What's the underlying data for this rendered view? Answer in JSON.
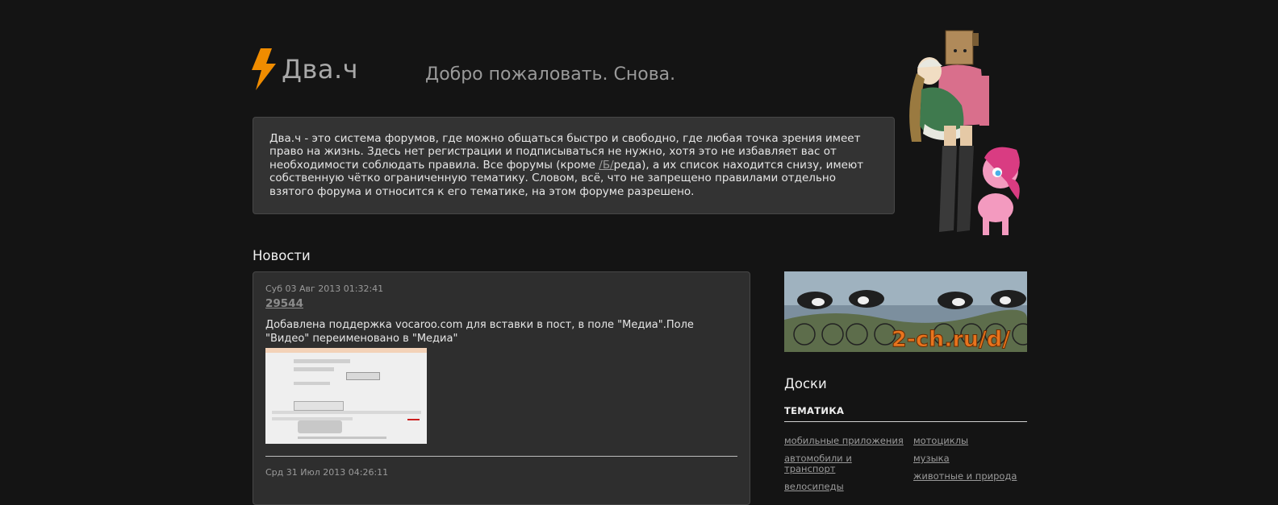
{
  "header": {
    "site_name": "Два.ч",
    "tagline": "Добро пожаловать. Снова.",
    "logo_icon": "lightning-bolt-icon",
    "accent_color": "#f08c00"
  },
  "intro": {
    "text_before": "Два.ч - это система форумов, где можно общаться быстро и свободно, где любая точка зрения имеет право на жизнь. Здесь нет регистрации и подписываться не нужно, хотя это не избавляет вас от необходимости соблюдать правила. Все форумы (кроме ",
    "link": "/Б/",
    "text_after": "реда), а их список находится снизу, имеют собственную чётко ограниченную тематику. Словом, всё, что не запрещено правилами отдельно взятого форума и относится к его тематике, на этом форуме разрешено."
  },
  "news": {
    "title": "Новости",
    "items": [
      {
        "date": "Суб 03 Авг 2013 01:32:41",
        "id": "29544",
        "text": "Добавлена поддержка vocaroo.com для вставки в пост, в поле \"Медиа\".Поле \"Видео\" переименовано в \"Медиа\""
      },
      {
        "date": "Срд 31 Июл 2013 04:26:11"
      }
    ]
  },
  "banner": {
    "text": "2-ch.ru/d/"
  },
  "boards": {
    "title": "Доски",
    "category": "ТЕМАТИКА",
    "col1": [
      "мобильные приложения",
      "автомобили и транспорт",
      "велосипеды"
    ],
    "col2": [
      "мотоциклы",
      "музыка",
      "животные и природа"
    ]
  }
}
